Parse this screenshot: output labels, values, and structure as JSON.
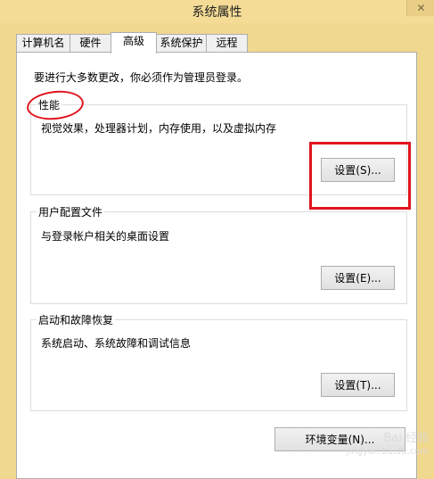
{
  "window": {
    "title": "系统属性",
    "close_glyph": "✕"
  },
  "tabs": [
    {
      "label": "计算机名"
    },
    {
      "label": "硬件"
    },
    {
      "label": "高级",
      "active": true
    },
    {
      "label": "系统保护"
    },
    {
      "label": "远程"
    }
  ],
  "panel": {
    "admin_note": "要进行大多数更改，你必须作为管理员登录。",
    "performance": {
      "label": "性能",
      "description": "视觉效果，处理器计划，内存使用，以及虚拟内存",
      "button": "设置(S)..."
    },
    "user_profiles": {
      "label": "用户配置文件",
      "description": "与登录帐户相关的桌面设置",
      "button": "设置(E)..."
    },
    "startup_recovery": {
      "label": "启动和故障恢复",
      "description": "系统启动、系统故障和调试信息",
      "button": "设置(T)..."
    },
    "env_button": "环境变量(N)..."
  },
  "watermark": {
    "line1": "Bai 经验",
    "line2": "jingyan.baidu.com"
  },
  "colors": {
    "annotation": "#e0141e",
    "title_bar": "#f4dc96"
  }
}
